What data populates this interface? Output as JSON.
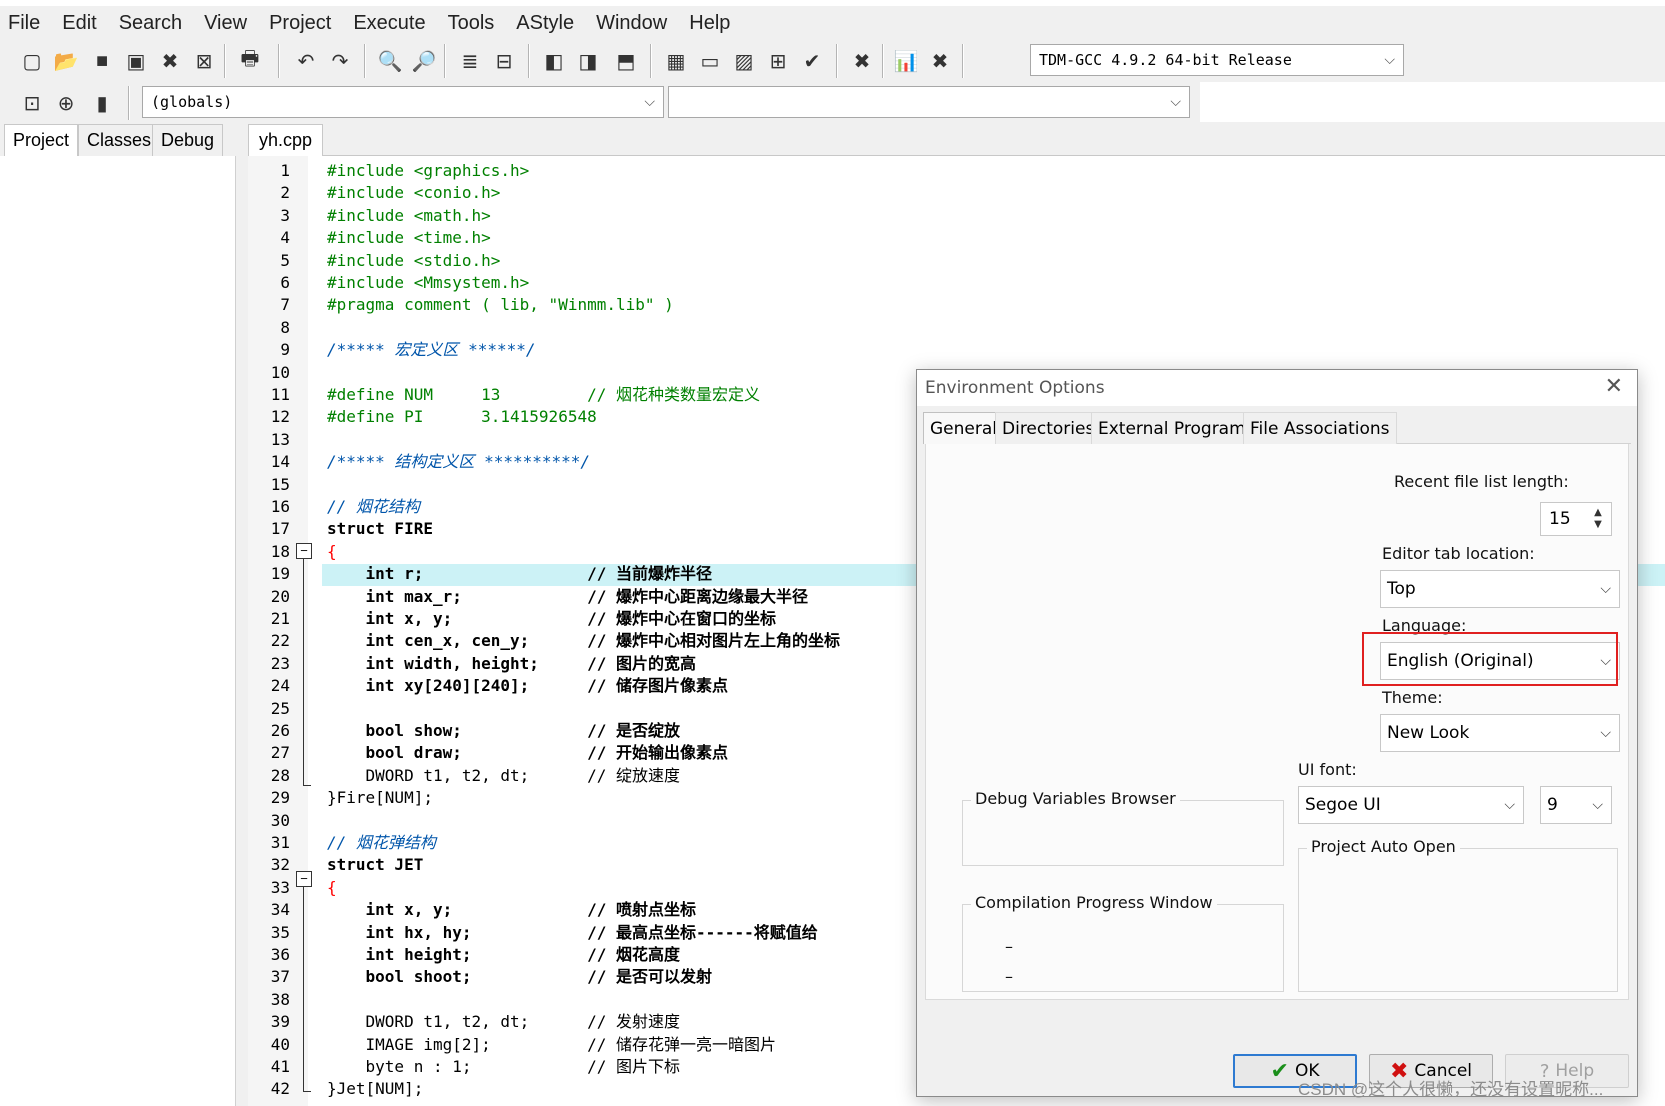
{
  "menu": [
    "File",
    "Edit",
    "Search",
    "View",
    "Project",
    "Execute",
    "Tools",
    "AStyle",
    "Window",
    "Help"
  ],
  "toolbar": {
    "compiler": "TDM-GCC 4.9.2 64-bit Release",
    "scope": "(globals)",
    "member": ""
  },
  "left_tabs": [
    "Project",
    "Classes",
    "Debug"
  ],
  "editor": {
    "file_tab": "yh.cpp",
    "line_numbers": [
      "1",
      "2",
      "3",
      "4",
      "5",
      "6",
      "7",
      "8",
      "9",
      "10",
      "11",
      "12",
      "13",
      "14",
      "15",
      "16",
      "17",
      "18",
      "19",
      "20",
      "21",
      "22",
      "23",
      "24",
      "25",
      "26",
      "27",
      "28",
      "29",
      "30",
      "31",
      "32",
      "33",
      "34",
      "35",
      "36",
      "37",
      "38",
      "39",
      "40",
      "41",
      "42"
    ],
    "lines": [
      "#include <graphics.h>",
      "#include <conio.h>",
      "#include <math.h>",
      "#include <time.h>",
      "#include <stdio.h>",
      "#include <Mmsystem.h>",
      "#pragma comment ( lib, \"Winmm.lib\" )",
      "",
      "/***** 宏定义区 ******/",
      "",
      "#define NUM     13         // 烟花种类数量宏定义",
      "#define PI      3.1415926548",
      "",
      "/***** 结构定义区 **********/",
      "",
      "// 烟花结构",
      "struct FIRE",
      "{",
      "    int r;                 // 当前爆炸半径",
      "    int max_r;             // 爆炸中心距离边缘最大半径",
      "    int x, y;              // 爆炸中心在窗口的坐标",
      "    int cen_x, cen_y;      // 爆炸中心相对图片左上角的坐标",
      "    int width, height;     // 图片的宽高",
      "    int xy[240][240];      // 储存图片像素点",
      "",
      "    bool show;             // 是否绽放",
      "    bool draw;             // 开始输出像素点",
      "    DWORD t1, t2, dt;      // 绽放速度",
      "}Fire[NUM];",
      "",
      "// 烟花弹结构",
      "struct JET",
      "{",
      "    int x, y;              // 喷射点坐标",
      "    int hx, hy;            // 最高点坐标------将赋值给",
      "    int height;            // 烟花高度",
      "    bool shoot;            // 是否可以发射",
      "",
      "    DWORD t1, t2, dt;      // 发射速度",
      "    IMAGE img[2];          // 储存花弹一亮一暗图片",
      "    byte n : 1;            // 图片下标",
      "}Jet[NUM];"
    ]
  },
  "dialog": {
    "title": "Environment Options",
    "tabs": [
      "General",
      "Directories",
      "External Programs",
      "File Associations"
    ],
    "recent_label": "Recent file list length:",
    "recent_value": "15",
    "editor_tab_label": "Editor tab location:",
    "editor_tab_value": "Top",
    "language_label": "Language:",
    "language_value": "English (Original)",
    "theme_label": "Theme:",
    "theme_value": "New Look",
    "ui_font_label": "UI font:",
    "ui_font_value": "Segoe UI",
    "ui_font_size": "9",
    "debug_group": "Debug Variables Browser",
    "compile_group": "Compilation Progress Window",
    "compile_items": [
      "–",
      "–"
    ],
    "project_group": "Project Auto Open",
    "ok": "OK",
    "cancel": "Cancel",
    "help": "Help"
  },
  "watermark": "CSDN @这个人很懒，还没有设置昵称...",
  "colors": {
    "keyword_include": "#008000",
    "comment": "#0055aa",
    "number": "#008000",
    "brace": "#ff0000",
    "highlight_row": "#ccf2f6",
    "language_highlight": "#e02020"
  }
}
